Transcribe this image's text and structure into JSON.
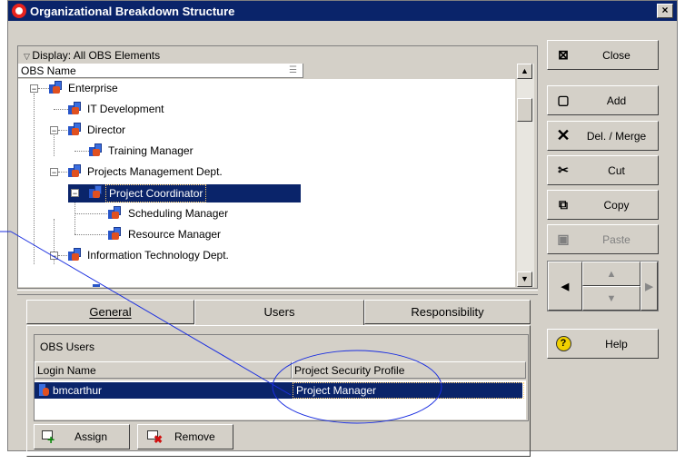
{
  "window": {
    "title": "Organizational Breakdown Structure",
    "close_glyph": "×"
  },
  "tree": {
    "display_label": "Display: All OBS Elements",
    "column_header": "OBS Name",
    "nodes": [
      {
        "label": "Enterprise"
      },
      {
        "label": "IT Development"
      },
      {
        "label": "Director"
      },
      {
        "label": "Training Manager"
      },
      {
        "label": "Projects Management Dept."
      },
      {
        "label": "Project Coordinator",
        "selected": true
      },
      {
        "label": "Scheduling Manager"
      },
      {
        "label": "Resource Manager"
      },
      {
        "label": "Information Technology Dept."
      }
    ]
  },
  "tabs": [
    {
      "label": "General",
      "active": false
    },
    {
      "label": "Users",
      "active": true
    },
    {
      "label": "Responsibility",
      "active": false
    }
  ],
  "users_panel": {
    "group_title": "OBS Users",
    "columns": [
      "Login Name",
      "Project Security Profile"
    ],
    "rows": [
      {
        "login": "bmcarthur",
        "profile": "Project Manager"
      }
    ],
    "assign_label": "Assign",
    "remove_label": "Remove"
  },
  "side_buttons": {
    "close": "Close",
    "add": "Add",
    "delete_merge": "Del. / Merge",
    "cut": "Cut",
    "copy": "Copy",
    "paste": "Paste",
    "help": "Help"
  },
  "colors": {
    "title_bar": "#0a246a",
    "selection": "#0a246a",
    "face": "#d4d0c8",
    "annotation": "#1a2ee0"
  }
}
